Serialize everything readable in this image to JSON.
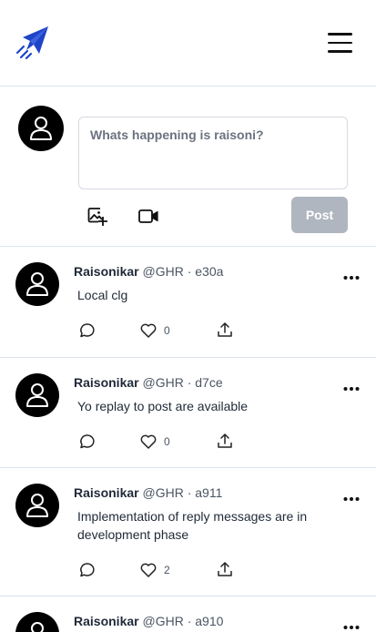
{
  "header": {
    "logo_icon": "paper-plane-rocket-icon",
    "menu_icon": "hamburger-menu-icon",
    "brand_color": "#1e44c8"
  },
  "composer": {
    "placeholder": "Whats happening is raisoni?",
    "value": "",
    "image_icon": "image-add-icon",
    "video_icon": "video-camera-icon",
    "post_label": "Post",
    "post_button_color": "#b0b6bf"
  },
  "posts": [
    {
      "author": "Raisonikar",
      "handle": "@GHR",
      "separator": "·",
      "post_id": "e30a",
      "text": "Local clg",
      "likes": "0"
    },
    {
      "author": "Raisonikar",
      "handle": "@GHR",
      "separator": "·",
      "post_id": "d7ce",
      "text": "Yo replay to post are available",
      "likes": "0"
    },
    {
      "author": "Raisonikar",
      "handle": "@GHR",
      "separator": "·",
      "post_id": "a911",
      "text": "Implementation of reply messages are in development phase",
      "likes": "2"
    },
    {
      "author": "Raisonikar",
      "handle": "@GHR",
      "separator": "·",
      "post_id": "a910",
      "text": "",
      "likes": ""
    }
  ],
  "post_actions": {
    "reply_icon": "comment-bubble-icon",
    "like_icon": "heart-icon",
    "share_icon": "share-upload-icon",
    "more_icon": "more-horizontal-icon"
  }
}
